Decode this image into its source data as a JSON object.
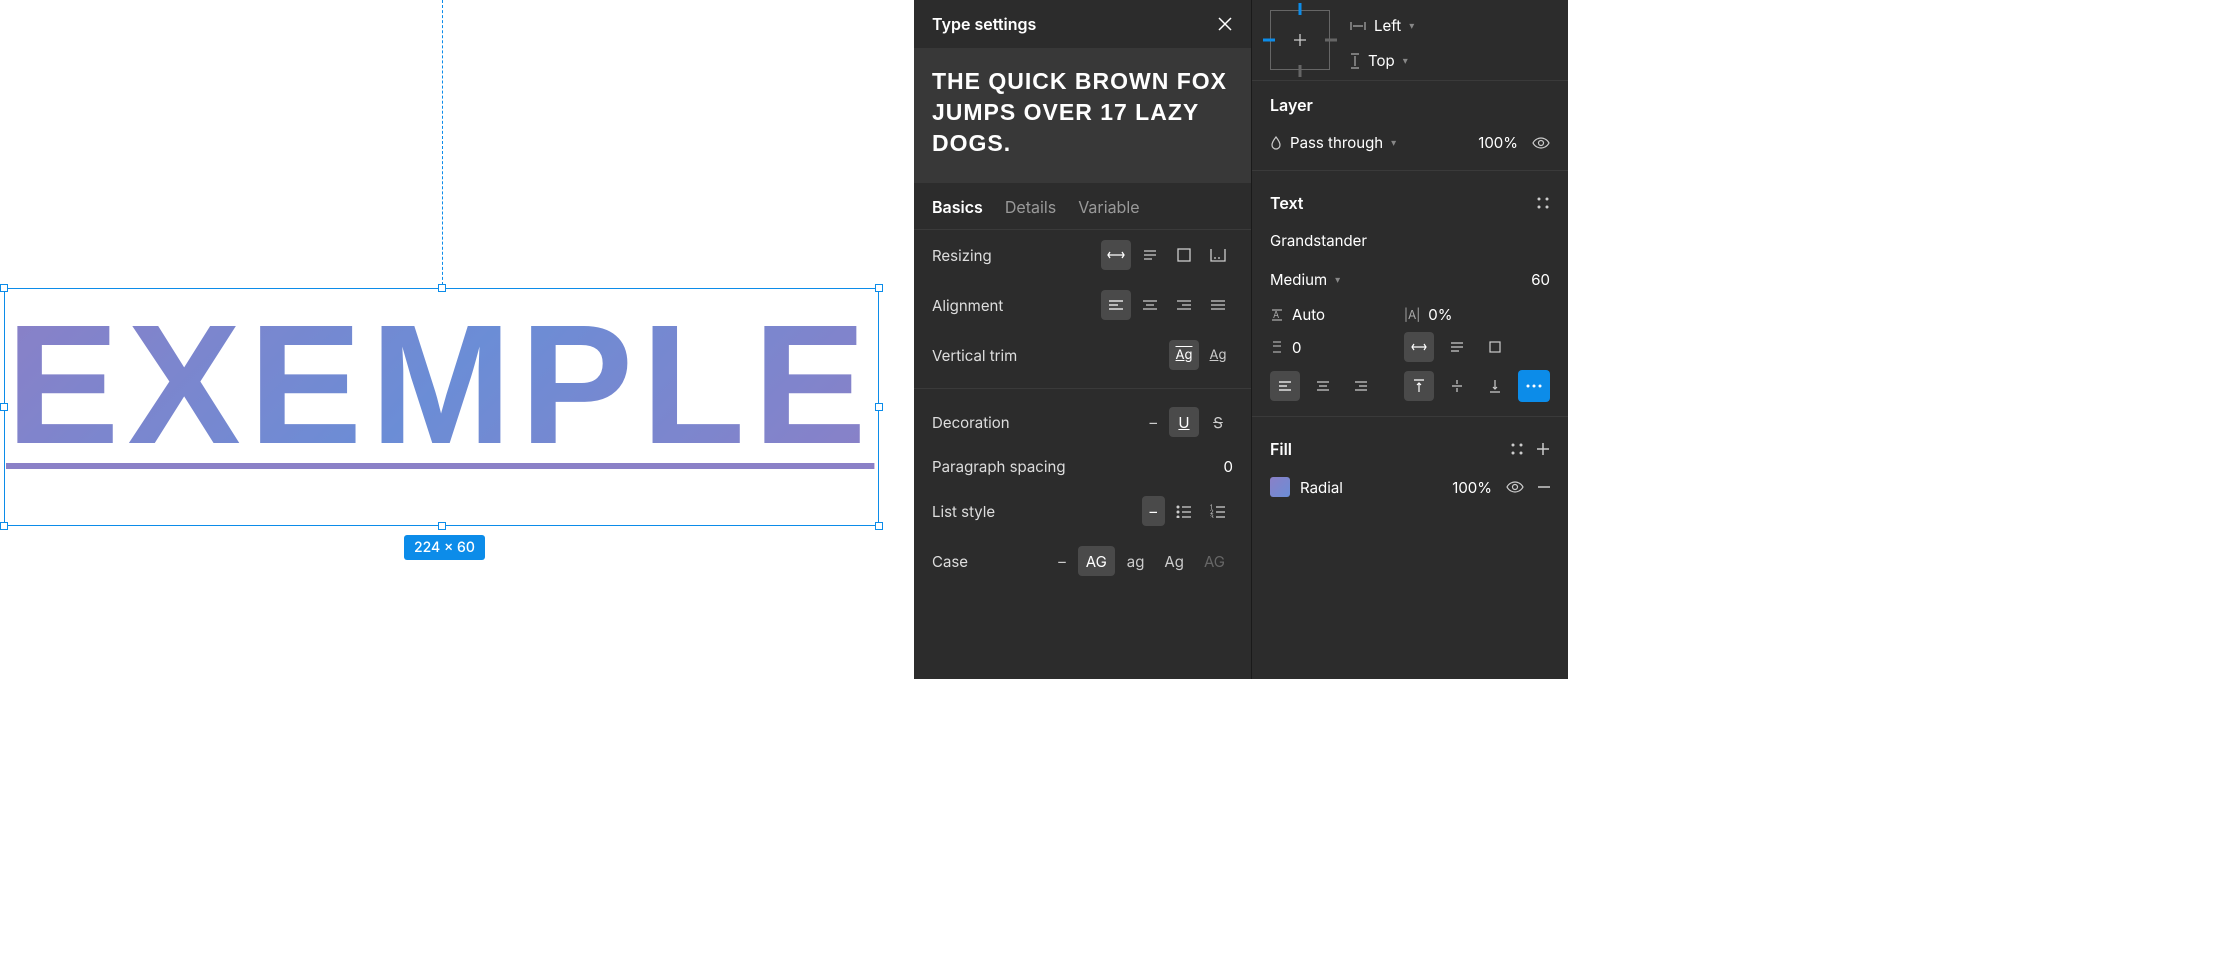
{
  "canvas": {
    "text": "EXEMPLE",
    "dimensions": "224 × 60"
  },
  "type_settings": {
    "title": "Type settings",
    "preview": "THE QUICK BROWN FOX JUMPS OVER 17 LAZY DOGS.",
    "tabs": {
      "basics": "Basics",
      "details": "Details",
      "variable": "Variable"
    },
    "resizing_label": "Resizing",
    "alignment_label": "Alignment",
    "vertical_trim_label": "Vertical trim",
    "decoration_label": "Decoration",
    "decoration_none": "–",
    "paragraph_spacing_label": "Paragraph spacing",
    "paragraph_spacing_value": "0",
    "list_style_label": "List style",
    "list_style_none": "–",
    "case_label": "Case",
    "case_none": "–",
    "case_upper": "AG",
    "case_lower": "ag",
    "case_title": "Ag",
    "case_small": "AG"
  },
  "props": {
    "constraint_h": "Left",
    "constraint_v": "Top",
    "layer_title": "Layer",
    "blend_mode": "Pass through",
    "opacity": "100%",
    "text_title": "Text",
    "font_family": "Grandstander",
    "font_weight": "Medium",
    "font_size": "60",
    "line_height": "Auto",
    "letter_spacing": "0%",
    "para_spacing": "0",
    "fill_title": "Fill",
    "fill_type": "Radial",
    "fill_opacity": "100%"
  }
}
